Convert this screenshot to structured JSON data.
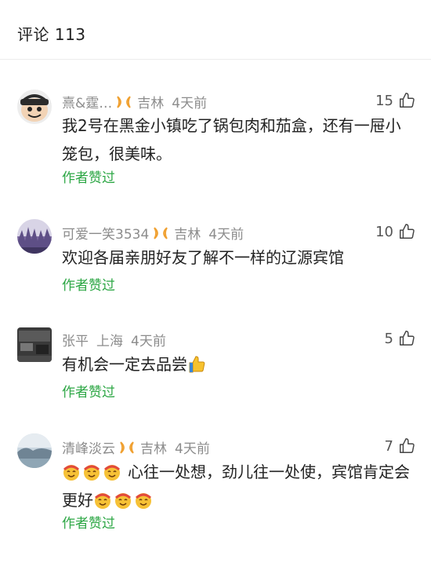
{
  "header": {
    "title": "评论 113"
  },
  "comments": [
    {
      "name": "熹&霆…",
      "location": "吉林",
      "time": "4天前",
      "likes": "15",
      "text_line1": "我2号在黑金小镇吃了锅包肉和茄盒，还有一屉小",
      "text_line2": "笼包，很美味。",
      "author_liked": "作者赞过"
    },
    {
      "name": "可爱一笑3534",
      "location": "吉林",
      "time": "4天前",
      "likes": "10",
      "text_line1": "欢迎各届亲朋好友了解不一样的辽源宾馆",
      "author_liked": "作者赞过"
    },
    {
      "name": "张平",
      "location": "上海",
      "time": "4天前",
      "likes": "5",
      "text_line1": "有机会一定去品尝",
      "author_liked": "作者赞过"
    },
    {
      "name": "清峰淡云",
      "location": "吉林",
      "time": "4天前",
      "likes": "7",
      "text_line1": "心往一处想，劲儿往一处使，宾馆肯定会",
      "text_line2": "更好",
      "author_liked": "作者赞过"
    }
  ],
  "colors": {
    "accent_green": "#2da745",
    "meta_gray": "#8c8c8c",
    "badge_orange": "#f0a030"
  },
  "icons": {
    "badge": "ribbon-badge-icon",
    "like": "thumbs-up-icon",
    "emoji": "smiling-face-emoji"
  }
}
